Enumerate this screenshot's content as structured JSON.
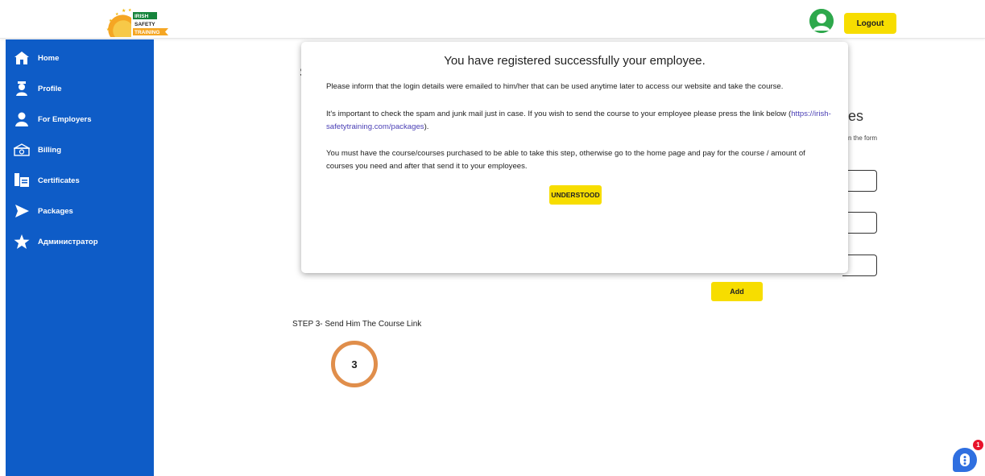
{
  "header": {
    "logo_text": [
      "IRISH",
      "SAFETY",
      "TRAINING"
    ],
    "logout_label": "Logout",
    "avatar_color": "#2ea84c"
  },
  "sidebar": {
    "color": "#0e5cc7",
    "items": [
      {
        "label": "Home",
        "icon": "home-icon"
      },
      {
        "label": "Profile",
        "icon": "user-profile-icon"
      },
      {
        "label": "For Employers",
        "icon": "person-icon"
      },
      {
        "label": "Billing",
        "icon": "billing-icon"
      },
      {
        "label": "Certificates",
        "icon": "certificate-icon"
      },
      {
        "label": "Packages",
        "icon": "arrow-right-icon"
      },
      {
        "label": "Администратор",
        "icon": "star-icon"
      }
    ]
  },
  "main": {
    "bg_s_char": "S",
    "heading_fragment": "es",
    "form_note_fragment": "n the form",
    "add_label": "Add",
    "step3_label": "STEP 3- Send Him The Course Link",
    "step3_number": "3"
  },
  "modal": {
    "title": "You have registered successfully your employee.",
    "p1": "Please inform that the login details were emailed to him/her that can be used anytime later to access our website and take the course.",
    "p2_text": "It's important to check the spam and junk mail just in case. If you wish to send the course to your employee please press the link below (",
    "p2_link": "https://irish-safetytraining.com/packages",
    "p2_end": ").",
    "p3": "You must have the course/courses purchased to be able to take this step, otherwise go to the home page and pay for the course / amount of courses you need and after that send it to your employees.",
    "button_label": "UNDERSTOOD"
  },
  "chat": {
    "badge_count": "1",
    "icon": "chat-icon",
    "color": "#2f6fe0"
  },
  "accent": "#f7dd00"
}
